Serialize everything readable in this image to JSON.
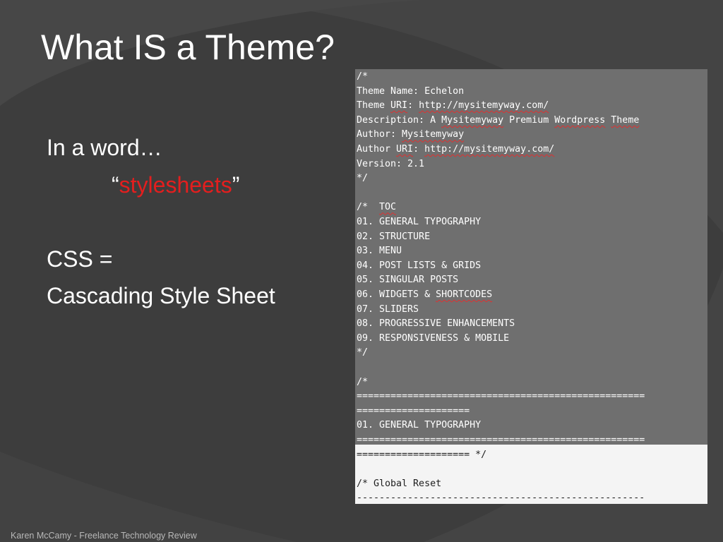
{
  "slide": {
    "title": "What IS a Theme?",
    "body": {
      "line1": "In a word…",
      "quote_open": "“",
      "quote_word": "stylesheets",
      "quote_close": "”",
      "line3": "CSS =",
      "line4": "Cascading Style Sheet"
    },
    "footer": "Karen McCamy - Freelance Technology Review"
  },
  "code_screenshot": {
    "lines": [
      [
        "/*"
      ],
      [
        "Theme Name: Echelon"
      ],
      [
        "Theme ",
        {
          "t": "URI",
          "sq": true
        },
        ": ",
        {
          "t": "http://mysitemyway.com/",
          "sq": true
        }
      ],
      [
        "Description: A ",
        {
          "t": "Mysitemyway",
          "sq": true
        },
        " Premium ",
        {
          "t": "Wordpress",
          "sq": true
        },
        " ",
        {
          "t": "Theme",
          "sq": true
        }
      ],
      [
        "Author: ",
        {
          "t": "Mysitemyway",
          "sq": true
        }
      ],
      [
        "Author ",
        {
          "t": "URI",
          "sq": true
        },
        ": ",
        {
          "t": "http://mysitemyway.com/",
          "sq": true
        }
      ],
      [
        "Version: 2.1"
      ],
      [
        "*/"
      ],
      [
        ""
      ],
      [
        "/*  ",
        {
          "t": "TOC",
          "sq": true
        }
      ],
      [
        "01. GENERAL TYPOGRAPHY"
      ],
      [
        "02. STRUCTURE"
      ],
      [
        "03. MENU"
      ],
      [
        "04. POST LISTS & GRIDS"
      ],
      [
        "05. SINGULAR POSTS"
      ],
      [
        "06. WIDGETS & ",
        {
          "t": "SHORTCODES",
          "sq": true
        }
      ],
      [
        "07. SLIDERS"
      ],
      [
        "08. PROGRESSIVE ENHANCEMENTS"
      ],
      [
        "09. RESPONSIVENESS & MOBILE"
      ],
      [
        "*/"
      ],
      [
        ""
      ],
      [
        "/*"
      ],
      [
        "==================================================="
      ],
      [
        "===================="
      ],
      [
        "01. GENERAL TYPOGRAPHY"
      ],
      [
        "==================================================="
      ],
      [
        "==================== */"
      ],
      [
        ""
      ],
      [
        "/* Global Reset"
      ],
      [
        "---------------------------------------------------"
      ]
    ]
  },
  "colors": {
    "background": "#3a3a3a",
    "title_text": "#ffffff",
    "accent_red": "#e41e1e",
    "code_panel": "#6f6f6f",
    "code_panel_light": "#f4f4f4",
    "squiggle": "#e03030"
  }
}
